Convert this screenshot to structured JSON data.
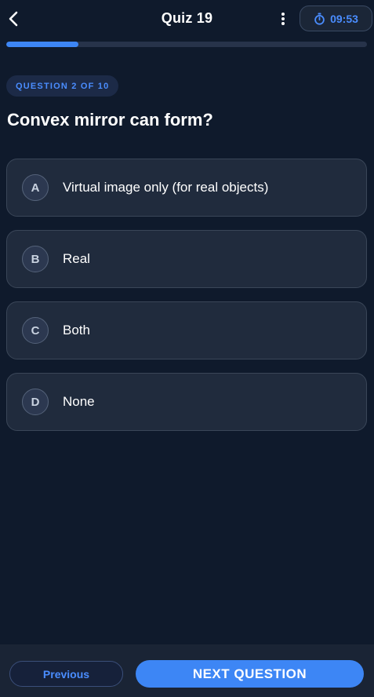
{
  "header": {
    "title": "Quiz 19",
    "timer": "09:53"
  },
  "progress": {
    "value": 0.2
  },
  "question": {
    "counter": "QUESTION 2 OF 10",
    "text": "Convex mirror can form?"
  },
  "options": [
    {
      "letter": "A",
      "text": "Virtual image only (for real objects)"
    },
    {
      "letter": "B",
      "text": "Real"
    },
    {
      "letter": "C",
      "text": "Both"
    },
    {
      "letter": "D",
      "text": "None"
    }
  ],
  "footer": {
    "previous_label": "Previous",
    "next_label": "NEXT QUESTION"
  },
  "colors": {
    "background": "#0f1a2c",
    "accent": "#3d86f5",
    "card": "#202b3d"
  },
  "icons": {
    "back": "chevron-left-icon",
    "more": "more-vertical-icon",
    "timer": "stopwatch-icon"
  }
}
